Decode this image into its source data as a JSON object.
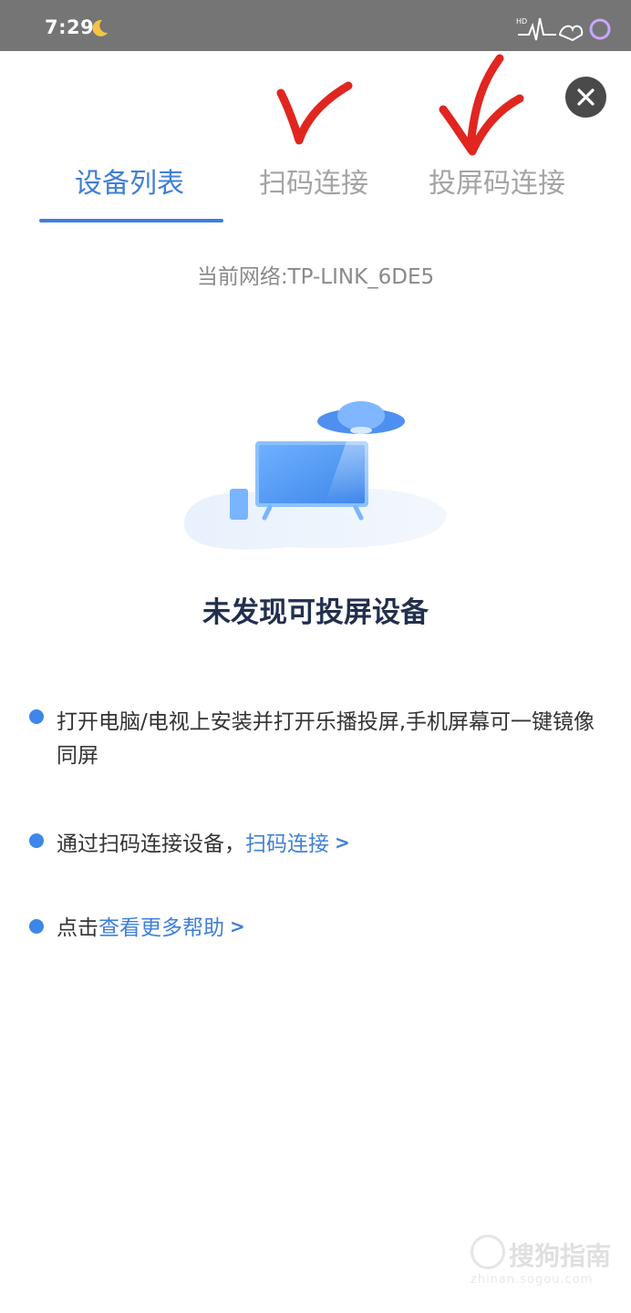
{
  "status_bar": {
    "time": "7:29",
    "icons": [
      "moon-icon",
      "hd-icon",
      "signal-icon",
      "wifi-icon",
      "battery-icon"
    ]
  },
  "tabs": [
    {
      "label": "设备列表",
      "active": true
    },
    {
      "label": "扫码连接",
      "active": false
    },
    {
      "label": "投屏码连接",
      "active": false
    }
  ],
  "network": {
    "label": "当前网络:TP-LINK_6DE5"
  },
  "empty_state": {
    "title": "未发现可投屏设备"
  },
  "tips": [
    {
      "text": "打开电脑/电视上安装并打开乐播投屏,手机屏幕可一键镜像同屏"
    },
    {
      "text": "通过扫码连接设备，",
      "link": "扫码连接"
    },
    {
      "prefix": "点击",
      "link": "查看更多帮助"
    }
  ],
  "watermark": {
    "text": "搜狗指南",
    "url": "zhinan.sogou.com"
  },
  "colors": {
    "accent": "#3f7fd8",
    "status_bar": "#757575",
    "title": "#22304d",
    "annotation": "#e0261f"
  }
}
